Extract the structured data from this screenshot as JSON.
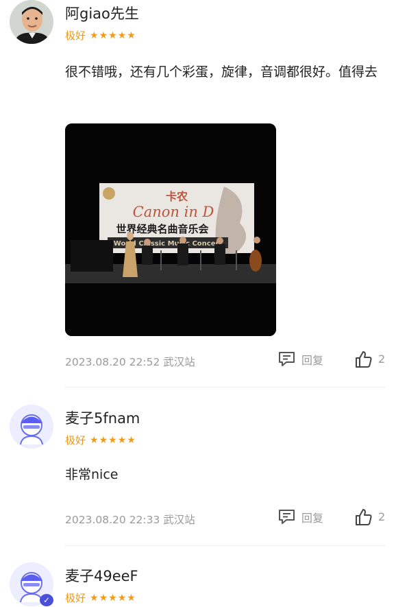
{
  "reviews": [
    {
      "username": "阿giao先生",
      "rating_label": "极好",
      "stars": 5,
      "content": "很不错哦，还有几个彩蛋，旋律，音调都很好。值得去",
      "photo": {
        "banner_title": "卡农",
        "banner_subtitle": "Canon in D",
        "banner_text": "世界经典名曲音乐会",
        "banner_sub_text": "World Classic Music Concert"
      },
      "timestamp": "2023.08.20 22:52",
      "location": "武汉站",
      "reply_label": "回复",
      "like_count": "2"
    },
    {
      "username": "麦子5fnam",
      "rating_label": "极好",
      "stars": 5,
      "content": "非常nice",
      "timestamp": "2023.08.20 22:33",
      "location": "武汉站",
      "reply_label": "回复",
      "like_count": "2"
    },
    {
      "username": "麦子49eeF",
      "rating_label": "极好",
      "stars": 5
    }
  ],
  "colors": {
    "accent": "#f39b17",
    "meta_text": "#9a9a9a"
  },
  "icons": {
    "reply": "comment-icon",
    "like": "thumbs-up-icon",
    "verified": "verified-badge-icon"
  }
}
